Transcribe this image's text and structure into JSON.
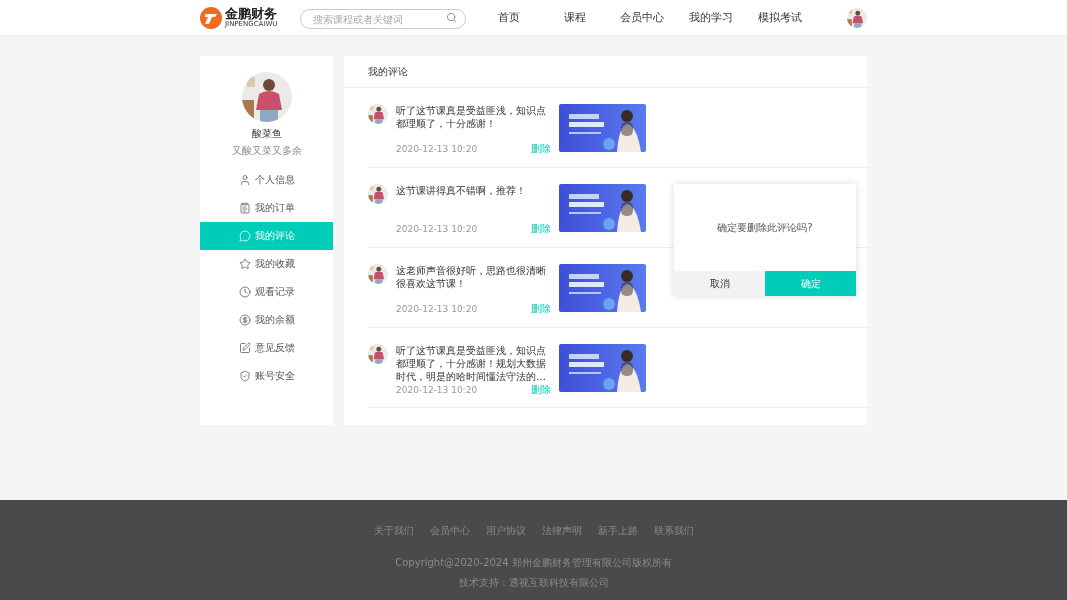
{
  "header": {
    "logo": {
      "name": "金鹏财务",
      "subtitle": "JINPENGCAIWU"
    },
    "search": {
      "placeholder": "搜索课程或者关键词"
    },
    "nav": [
      {
        "label": "首页",
        "selected": false
      },
      {
        "label": "课程",
        "selected": false
      },
      {
        "label": "会员中心",
        "selected": false
      },
      {
        "label": "我的学习",
        "selected": false
      },
      {
        "label": "模拟考试",
        "selected": false
      }
    ]
  },
  "profile": {
    "name": "酸菜鱼",
    "motto": "又酸又菜又多余"
  },
  "sidebar": {
    "items": [
      {
        "label": "个人信息",
        "selected": false
      },
      {
        "label": "我的订单",
        "selected": false
      },
      {
        "label": "我的评论",
        "selected": true
      },
      {
        "label": "我的收藏",
        "selected": false
      },
      {
        "label": "观看记录",
        "selected": false
      },
      {
        "label": "我的余额",
        "selected": false
      },
      {
        "label": "意见反馈",
        "selected": false
      },
      {
        "label": "账号安全",
        "selected": false
      }
    ]
  },
  "content": {
    "title": "我的评论",
    "comments": [
      {
        "text": "听了这节课真是受益匪浅，知识点都理顺了，十分感谢！",
        "time": "2020-12-13  10:20",
        "action": "删除"
      },
      {
        "text": "这节课讲得真不错啊，推荐！",
        "time": "2020-12-13  10:20",
        "action": "删除"
      },
      {
        "text": "这老师声音很好听，思路也很清晰很喜欢这节课！",
        "time": "2020-12-13  10:20",
        "action": "删除"
      },
      {
        "text": "听了这节课真是受益匪浅，知识点都理顺了，十分感谢！规划大数据时代，明是的哈时间懂法守法的…",
        "time": "2020-12-13  10:20",
        "action": "删除"
      }
    ]
  },
  "dialog": {
    "message": "确定要删除此评论吗?",
    "cancel": "取消",
    "confirm": "确定"
  },
  "footer": {
    "links": [
      "关于我们",
      "会员中心",
      "用户协议",
      "法律声明",
      "新手上路",
      "联系我们"
    ],
    "copyright": "Copyright@2020-2024 郑州金鹏财务管理有限公司版权所有",
    "support": "技术支持：透视互联科技有限公司"
  }
}
